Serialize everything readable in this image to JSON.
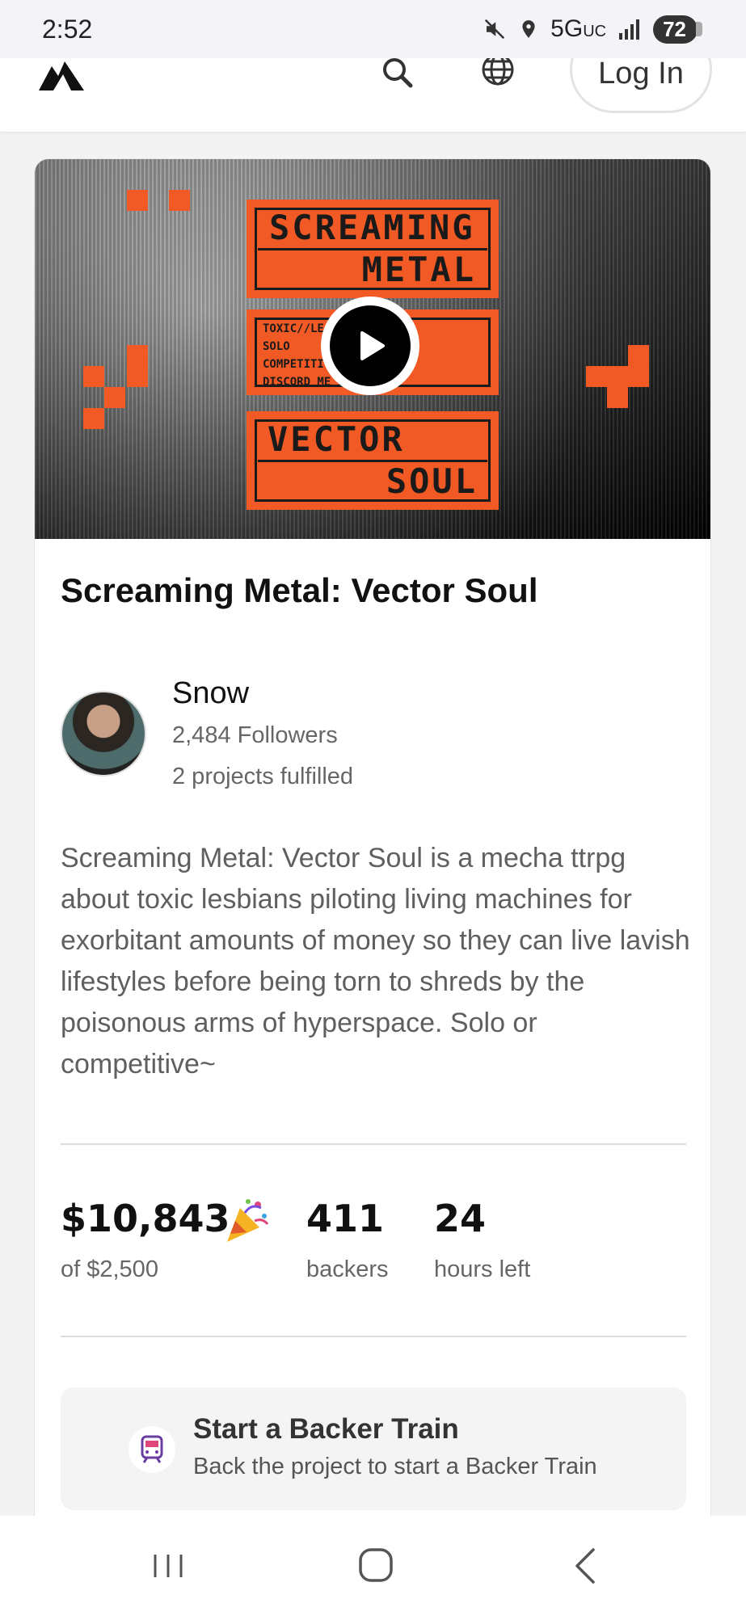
{
  "status_bar": {
    "time": "2:52",
    "network": "5G",
    "network_suffix": "UC",
    "battery": "72"
  },
  "header": {
    "login_label": "Log In"
  },
  "project": {
    "title": "Screaming Metal: Vector Soul",
    "poster": {
      "top_line1": "SCREAMING",
      "top_line2": "METAL",
      "bottom_line1": "VECTOR",
      "bottom_line2": "SOUL",
      "info_rows": [
        "TOXIC//LE        HA-TTRPG",
        "SOLO",
        "COMPETITI",
        "DISCORD ME              18+"
      ]
    },
    "creator": {
      "name": "Snow",
      "followers": "2,484 Followers",
      "projects": "2 projects fulfilled"
    },
    "blurb": "Screaming Metal: Vector Soul is a mecha ttrpg about toxic lesbians piloting living machines for exorbitant amounts of money so they can live lavish lifestyles before being torn to shreds by the poisonous arms of hyperspace. Solo or competitive~",
    "stats": {
      "pledged": "$10,843",
      "goal": "of $2,500",
      "backers": "411",
      "backers_label": "backers",
      "time_left": "24",
      "time_left_label": "hours left"
    },
    "backer_train": {
      "title": "Start a Backer Train",
      "subtitle": "Back the project to start a Backer Train"
    }
  },
  "colors": {
    "accent": "#f15a24"
  }
}
